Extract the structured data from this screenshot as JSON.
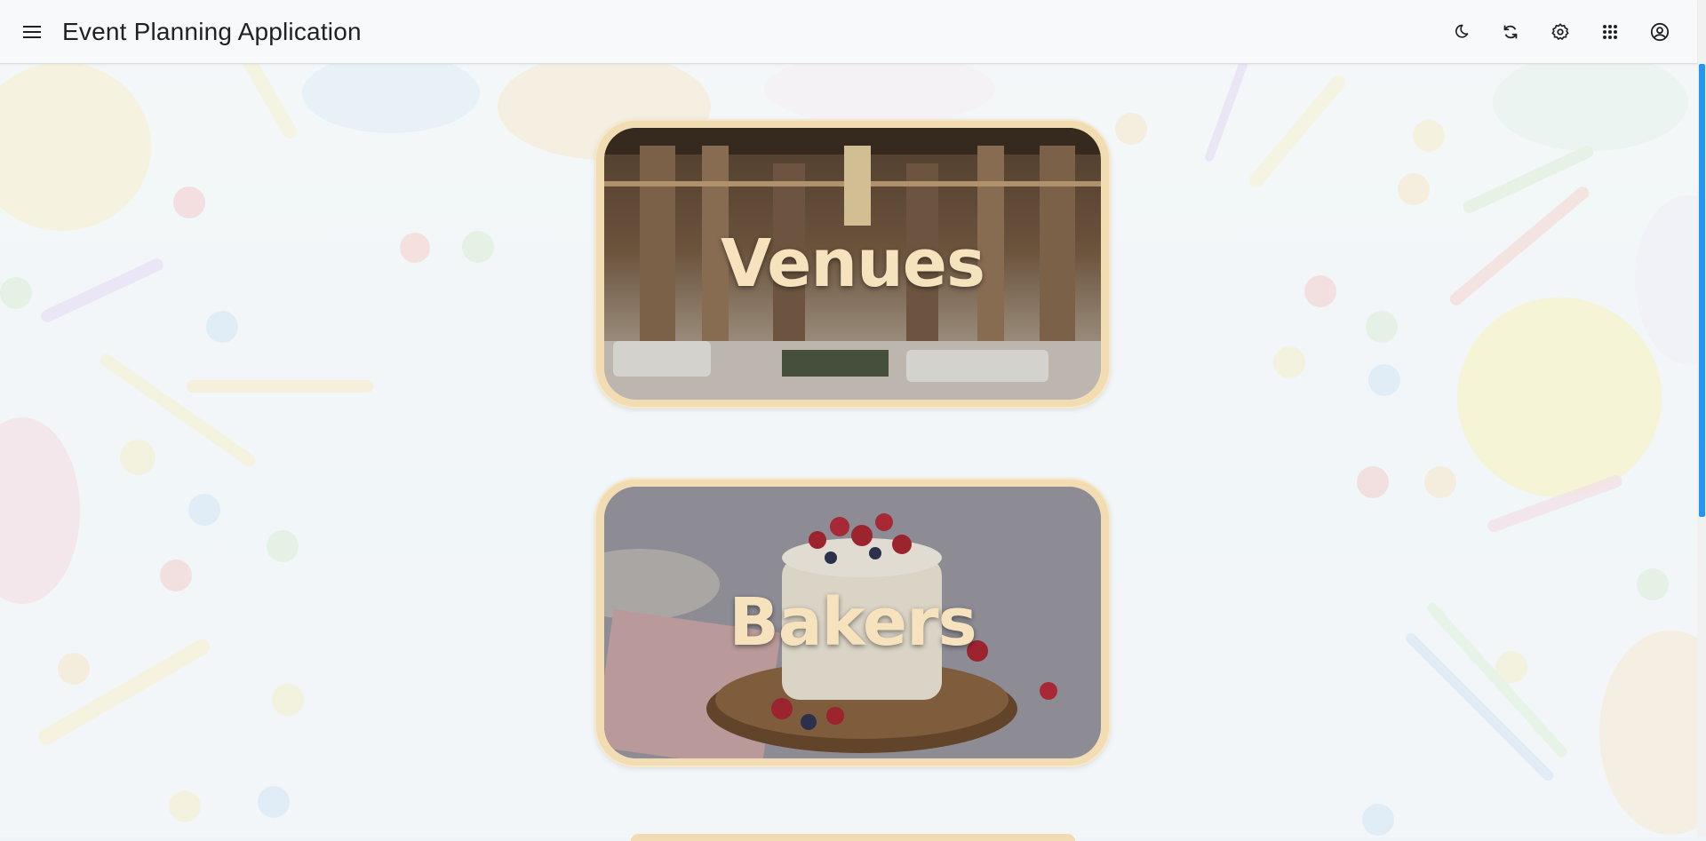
{
  "app": {
    "title": "Event Planning Application"
  },
  "header": {
    "menu_icon": "menu-icon",
    "actions": [
      "dark-mode-icon",
      "sync-icon",
      "settings-icon",
      "apps-grid-icon",
      "account-icon"
    ]
  },
  "cards": [
    {
      "label": "Venues"
    },
    {
      "label": "Bakers"
    }
  ],
  "colors": {
    "card_border": "#f1dcb3",
    "card_text": "#f6e2bd",
    "scroll_accent": "#2196f3"
  }
}
